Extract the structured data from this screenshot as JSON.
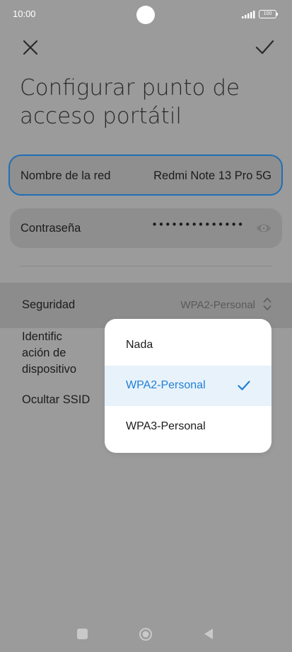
{
  "status": {
    "time": "10:00",
    "battery": "100"
  },
  "toolbar": {
    "close_icon": "close-icon",
    "confirm_icon": "check-icon"
  },
  "title": "Configurar punto de acceso portátil",
  "network_name": {
    "label": "Nombre de la red",
    "value": "Redmi Note 13 Pro 5G"
  },
  "password": {
    "label": "Contraseña",
    "value": "••••••••••••••",
    "icon": "eye-icon"
  },
  "security": {
    "label": "Seguridad",
    "value": "WPA2-Personal",
    "icon": "chevron-updown-icon"
  },
  "device_id": {
    "label": "Identific\nación de\ndispositivo"
  },
  "hide_ssid": {
    "label": "Ocultar SSID"
  },
  "dropdown": {
    "options": [
      {
        "label": "Nada",
        "selected": false
      },
      {
        "label": "WPA2-Personal",
        "selected": true
      },
      {
        "label": "WPA3-Personal",
        "selected": false
      }
    ]
  },
  "colors": {
    "accent": "#1f7fd6",
    "focus_border": "#1f6fb5",
    "overlay_bg": "#9b9b9b"
  },
  "navbar": {
    "recents_icon": "square-icon",
    "home_icon": "home-circle-icon",
    "back_icon": "back-triangle-icon"
  }
}
